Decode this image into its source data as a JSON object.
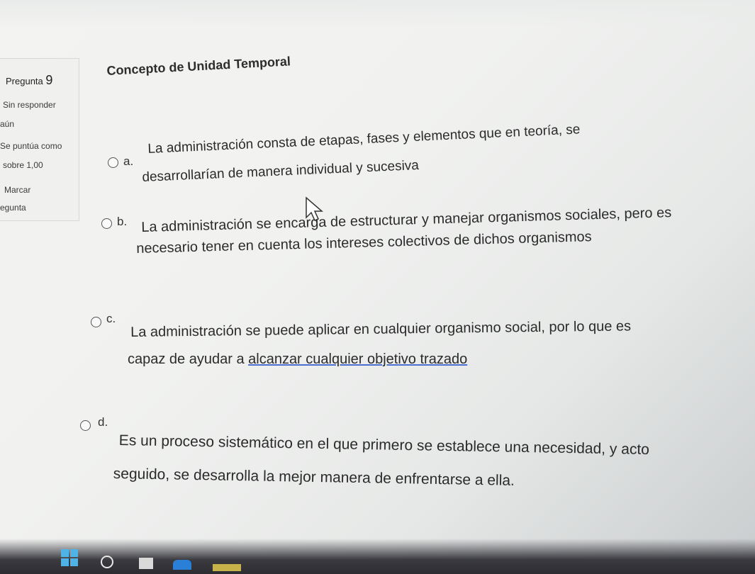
{
  "info": {
    "question_label": "Pregunta",
    "question_number": "9",
    "state_line1": "Sin responder",
    "state_line2": "aún",
    "score_line1": "Se puntúa como",
    "score_line2": "sobre 1,00",
    "flag_label": "Marcar",
    "flag_label2": "egunta"
  },
  "question": {
    "title": "Concepto de Unidad Temporal"
  },
  "options": [
    {
      "letter": "a.",
      "lines": [
        "La administración consta de etapas, fases y elementos que en teoría, se",
        "desarrollarían de manera individual y sucesiva"
      ]
    },
    {
      "letter": "b.",
      "lines": [
        "La administración se encarga de estructurar y manejar organismos sociales, pero es",
        "necesario tener en cuenta los intereses colectivos de dichos organismos"
      ]
    },
    {
      "letter": "c.",
      "lines": [
        "La administración se puede aplicar en cualquier organismo social, por lo que es",
        "capaz de ayudar a",
        "alcanzar cualquier objetivo trazado"
      ]
    },
    {
      "letter": "d.",
      "lines": [
        "Es un proceso sistemático en el que primero se establece una necesidad, y acto",
        "seguido, se desarrolla la mejor manera de enfrentarse a ella."
      ]
    }
  ],
  "taskbar": {
    "icons": [
      "windows-start-icon",
      "search-icon",
      "file-explorer-icon",
      "app-icon",
      "app-icon"
    ]
  },
  "colors": {
    "underline": "#4a6fd0",
    "windows_blue": "#4fb3e8"
  }
}
